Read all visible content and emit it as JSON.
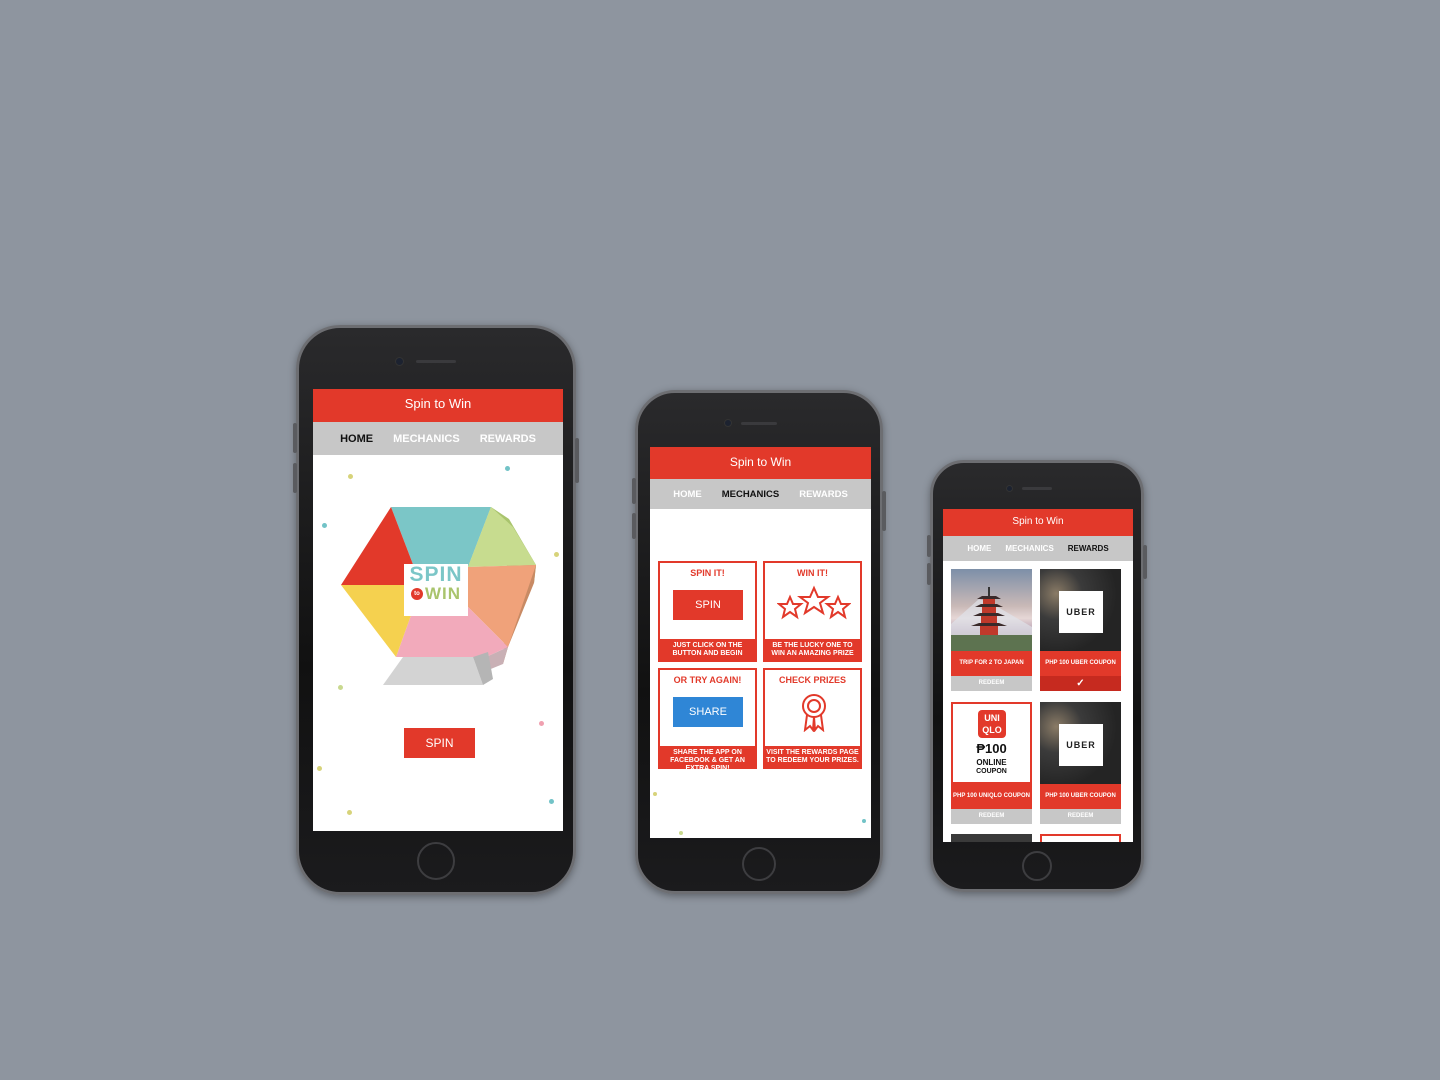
{
  "app_title": "Spin to Win",
  "nav": {
    "home": "HOME",
    "mechanics": "MECHANICS",
    "rewards": "REWARDS"
  },
  "colors": {
    "background": "#8e959f",
    "brand_red": "#e2392a",
    "nav_gray": "#c7c7c7",
    "share_blue": "#2f86d6"
  },
  "home": {
    "logo_top": "SPIN",
    "logo_mid": "to",
    "logo_bottom": "WIN",
    "spin_button": "SPIN"
  },
  "mechanics": {
    "cards": [
      {
        "title": "SPIN IT!",
        "button": "SPIN",
        "footer": "JUST CLICK ON THE BUTTON AND BEGIN",
        "icon": "button"
      },
      {
        "title": "WIN IT!",
        "footer": "BE THE LUCKY ONE TO WIN AN AMAZING PRIZE",
        "icon": "stars-icon"
      },
      {
        "title": "OR TRY AGAIN!",
        "button": "SHARE",
        "footer": "SHARE THE APP ON FACEBOOK & GET AN EXTRA SPIN!",
        "icon": "button"
      },
      {
        "title": "CHECK PRIZES",
        "footer": "VISIT THE REWARDS PAGE TO REDEEM YOUR PRIZES.",
        "icon": "ribbon-icon"
      }
    ]
  },
  "rewards": {
    "items": [
      {
        "label": "TRIP FOR 2 TO JAPAN",
        "action": "REDEEM",
        "image": "pagoda-photo"
      },
      {
        "label": "PHP 100 UBER COUPON",
        "action": "✓",
        "image": "uber-logo",
        "logo_text": "UBER"
      },
      {
        "label": "PHP 100 UNIQLO COUPON",
        "action": "REDEEM",
        "image": "uniqlo-logo",
        "logo_text_1": "UNI",
        "logo_text_2": "QLO",
        "amount": "₱100",
        "line1": "ONLINE",
        "line2": "COUPON"
      },
      {
        "label": "PHP 100 UBER COUPON",
        "action": "REDEEM",
        "image": "uber-logo",
        "logo_text": "UBER"
      }
    ]
  }
}
